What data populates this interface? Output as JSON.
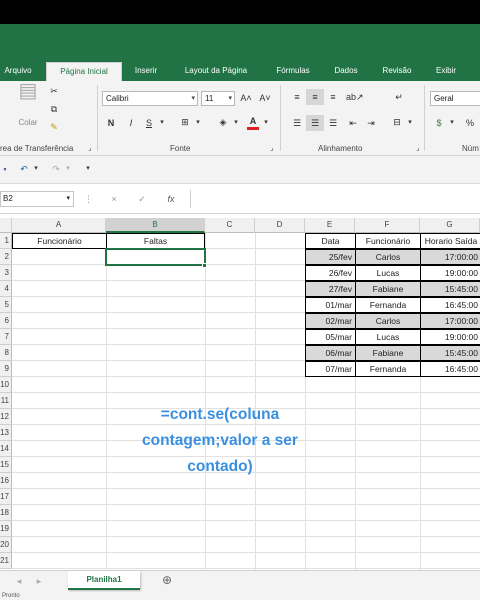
{
  "ribbon_tabs": [
    "Arquivo",
    "Página Inicial",
    "Inserir",
    "Layout da Página",
    "Fórmulas",
    "Dados",
    "Revisão",
    "Exibir"
  ],
  "active_tab": "Página Inicial",
  "clipboard": {
    "paste_label": "Colar",
    "group_label": "rea de Transferência"
  },
  "font": {
    "name": "Calibri",
    "size": "11",
    "bold": "N",
    "italic": "I",
    "underline": "S",
    "group_label": "Fonte"
  },
  "alignment": {
    "group_label": "Alinhamento"
  },
  "number": {
    "format": "Geral",
    "percent": "%",
    "group_label": "Núm"
  },
  "name_box": "B2",
  "formula_icons": {
    "cancel": "×",
    "confirm": "✓",
    "fx": "fx"
  },
  "columns": [
    "A",
    "B",
    "C",
    "D",
    "E",
    "F",
    "G"
  ],
  "rows": [
    "1",
    "2",
    "3",
    "4",
    "5",
    "6",
    "7",
    "8",
    "9",
    "10",
    "11",
    "12",
    "13",
    "14",
    "15",
    "16",
    "17",
    "18",
    "19",
    "20",
    "21"
  ],
  "cells": {
    "A1": "Funcionário",
    "B1": "Faltas"
  },
  "table": {
    "headers": [
      "Data",
      "Funcionário",
      "Horario Saída"
    ],
    "rows": [
      [
        "25/fev",
        "Carlos",
        "17:00:00"
      ],
      [
        "26/fev",
        "Lucas",
        "19:00:00"
      ],
      [
        "27/fev",
        "Fabiane",
        "15:45:00"
      ],
      [
        "01/mar",
        "Fernanda",
        "16:45:00"
      ],
      [
        "02/mar",
        "Carlos",
        "17:00:00"
      ],
      [
        "05/mar",
        "Lucas",
        "19:00:00"
      ],
      [
        "06/mar",
        "Fabiane",
        "15:45:00"
      ],
      [
        "07/mar",
        "Fernanda",
        "16:45:00"
      ]
    ]
  },
  "overlay_text": [
    "=cont.se(coluna",
    "contagem;valor a ser",
    "contado)"
  ],
  "sheet_tab": "Planilha1",
  "add_sheet": "⊕",
  "status": "Pronto",
  "colors": {
    "excel_green": "#217346",
    "overlay_blue": "#3a8fe0",
    "table_shade": "#d9d9d9"
  }
}
